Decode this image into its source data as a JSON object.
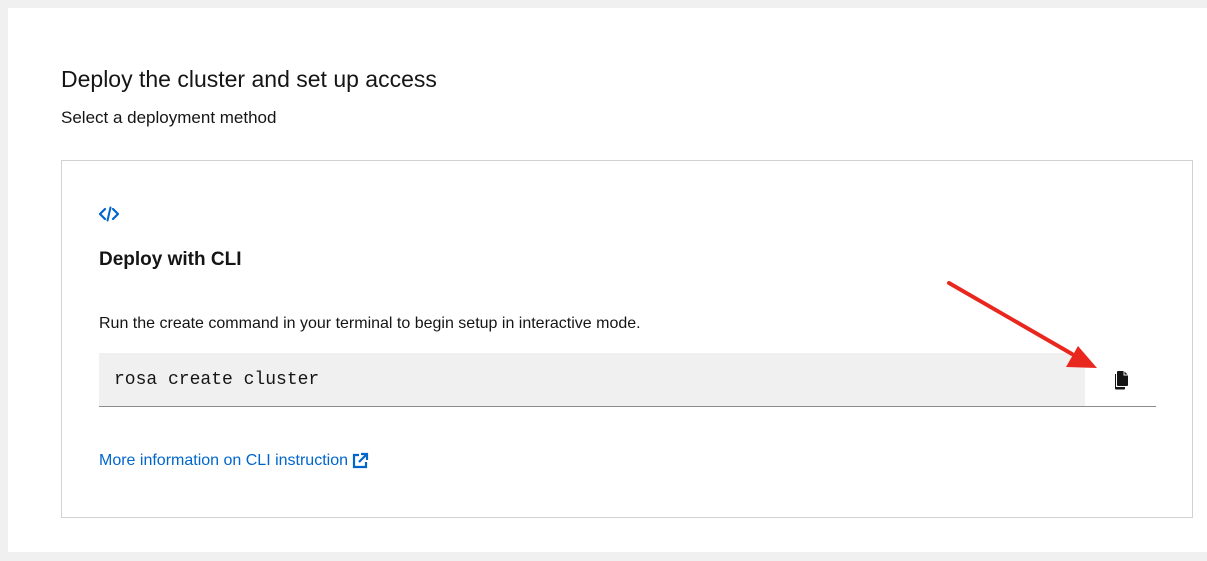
{
  "header": {
    "title": "Deploy the cluster and set up access",
    "subtitle": "Select a deployment method"
  },
  "cli_card": {
    "icon": "code-icon",
    "title": "Deploy with CLI",
    "description": "Run the create command in your terminal to begin setup in interactive mode.",
    "command": "rosa create cluster",
    "copy_icon": "copy-icon",
    "more_info_link": "More information on CLI instruction",
    "external_icon": "external-link-icon"
  },
  "annotation": {
    "arrow_color": "#e8281e"
  },
  "colors": {
    "link": "#0066cc",
    "code_background": "#f0f0f0",
    "border": "#d2d2d2"
  }
}
